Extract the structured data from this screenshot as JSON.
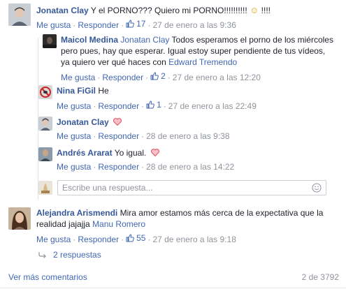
{
  "comments": [
    {
      "author": "Jonatan Clay",
      "text": "Y el PORNO??? Quiero mi PORNO!!!!!!!!!!",
      "emoji": "☺",
      "text_after": "!!!!",
      "like": "Me gusta",
      "reply": "Responder",
      "likes": "17",
      "time": "27 de enero a las 9:36"
    }
  ],
  "replies": [
    {
      "author": "Maicol Medina",
      "mention": "Jonatan Clay",
      "text": "Todos esperamos el porno de los miércoles pero pues, hay que esperar. Igual estoy super pendiente de tus vídeos, ya quiero ver qué haces con",
      "mention2": "Edward Tremendo",
      "like": "Me gusta",
      "reply": "Responder",
      "likes": "2",
      "time": "27 de enero a las 12:20"
    },
    {
      "author": "Nina FiGil",
      "text": "He",
      "like": "Me gusta",
      "reply": "Responder",
      "likes": "1",
      "time": "27 de enero a las 22:49"
    },
    {
      "author": "Jonatan Clay",
      "like": "Me gusta",
      "reply": "Responder",
      "time": "28 de enero a las 9:38"
    },
    {
      "author": "Andrés Ararat",
      "text": "Yo igual.",
      "like": "Me gusta",
      "reply": "Responder",
      "time": "28 de enero a las 14:22"
    }
  ],
  "reply_input": {
    "placeholder": "Escribe una respuesta..."
  },
  "comment2": {
    "author": "Alejandra Arismendi",
    "text": "Mira amor estamos más cerca de la expectativa que la realidad jajajja",
    "mention": "Manu Romero",
    "like": "Me gusta",
    "reply": "Responder",
    "likes": "55",
    "time": "27 de enero a las 9:18",
    "replies_link": "2 respuestas"
  },
  "footer": {
    "more": "Ver más comentarios",
    "count": "2 de 3792"
  },
  "colors": {
    "link": "#4267b2",
    "name": "#365899",
    "meta": "#90949c",
    "heart": "#f25268"
  }
}
